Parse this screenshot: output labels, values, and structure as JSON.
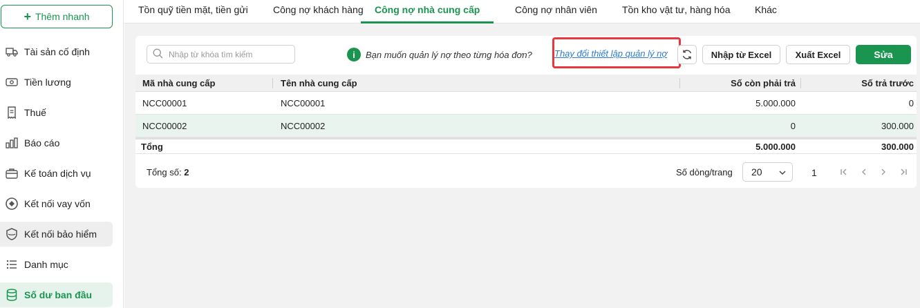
{
  "sidebar": {
    "quick_add": "Thêm nhanh",
    "items": [
      {
        "label": "Tài sản cố định",
        "icon": "truck-icon"
      },
      {
        "label": "Tiền lương",
        "icon": "money-icon"
      },
      {
        "label": "Thuế",
        "icon": "receipt-icon"
      },
      {
        "label": "Báo cáo",
        "icon": "bar-chart-icon"
      },
      {
        "label": "Kế toán dịch vụ",
        "icon": "briefcase-icon"
      },
      {
        "label": "Kết nối vay vốn",
        "icon": "loan-icon"
      },
      {
        "label": "Kết nối bảo hiểm",
        "icon": "shield-icon"
      },
      {
        "label": "Danh mục",
        "icon": "list-icon"
      },
      {
        "label": "Số dư ban đầu",
        "icon": "database-icon"
      }
    ]
  },
  "tabs": [
    "Tồn quỹ tiền mặt, tiền gửi",
    "Công nợ khách hàng",
    "Công nợ nhà cung cấp",
    "Công nợ nhân viên",
    "Tồn kho vật tư, hàng hóa",
    "Khác"
  ],
  "active_tab": "Công nợ nhà cung cấp",
  "toolbar": {
    "search_placeholder": "Nhập từ khóa tìm kiếm",
    "hint_text": "Bạn muốn quản lý nợ theo từng hóa đơn?",
    "hint_link": "Thay đổi thiết lập quản lý nợ",
    "import_label": "Nhập từ Excel",
    "export_label": "Xuất Excel",
    "edit_label": "Sửa"
  },
  "table": {
    "columns": [
      "Mã nhà cung cấp",
      "Tên nhà cung cấp",
      "Số còn phải trả",
      "Số trả trước"
    ],
    "rows": [
      [
        "NCC00001",
        "NCC00001",
        "5.000.000",
        "0"
      ],
      [
        "NCC00002",
        "NCC00002",
        "0",
        "300.000"
      ]
    ],
    "total": {
      "label": "Tổng",
      "payable": "5.000.000",
      "prepaid": "300.000"
    }
  },
  "footer": {
    "total_label": "Tổng số:",
    "total_count": "2",
    "rows_per_page_label": "Số dòng/trang",
    "rows_per_page": "20",
    "page": "1"
  },
  "colors": {
    "accent": "#1a9550",
    "link": "#2b7bd6",
    "highlight": "#e8383d"
  }
}
